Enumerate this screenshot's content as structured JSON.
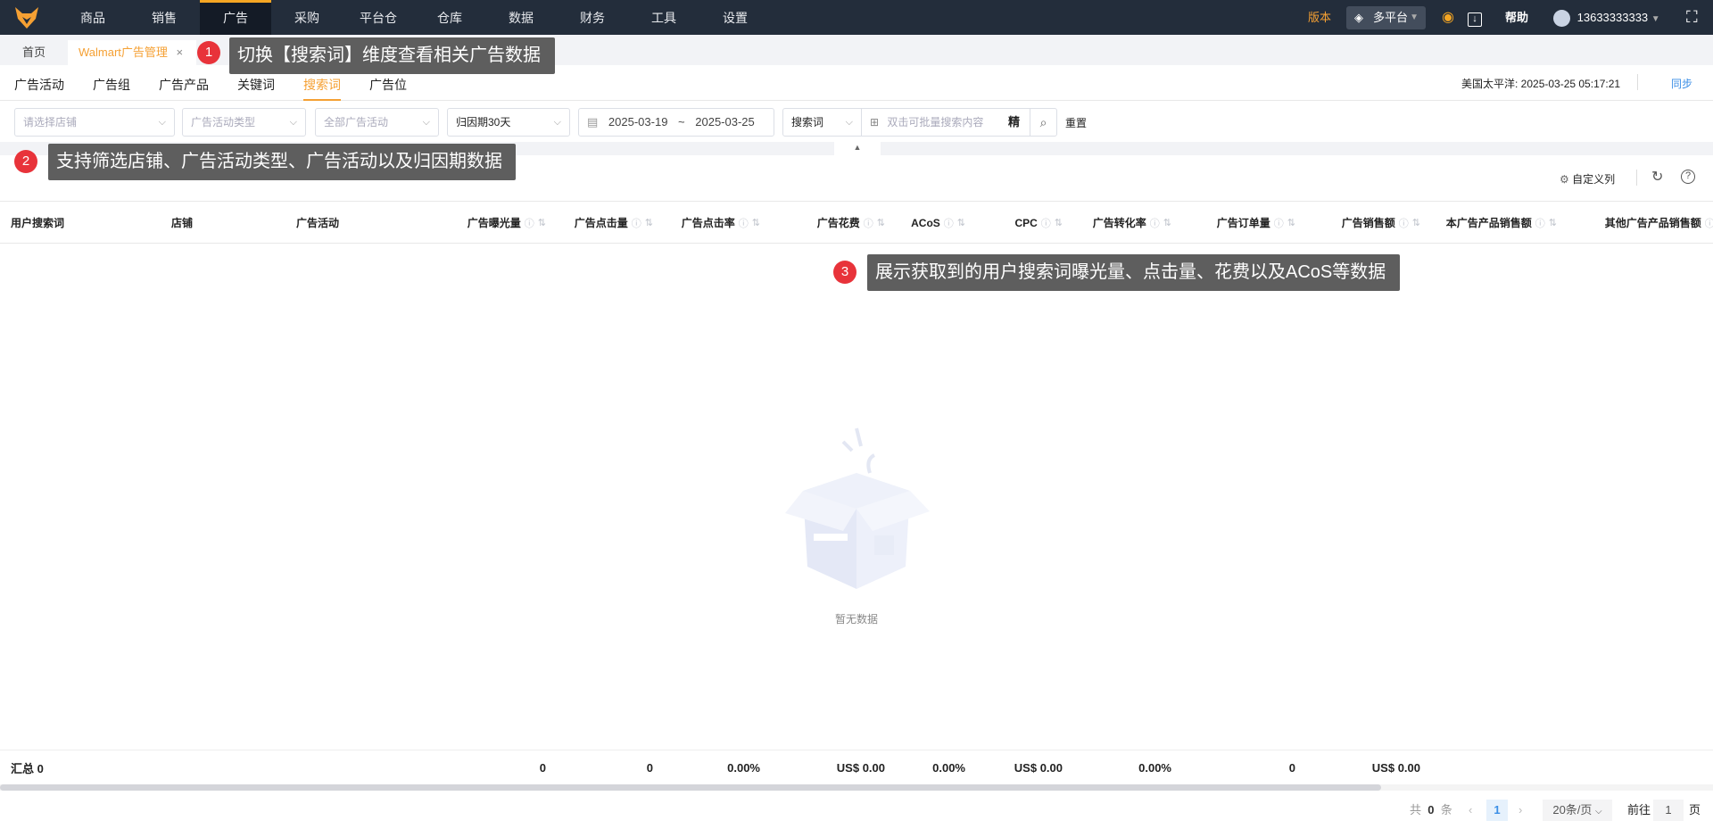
{
  "topnav": {
    "items": [
      "商品",
      "销售",
      "广告",
      "采购",
      "平台仓",
      "仓库",
      "数据",
      "财务",
      "工具",
      "设置"
    ],
    "active": "广告",
    "version": "版本",
    "platform": "多平台",
    "help": "帮助",
    "user": "13633333333"
  },
  "tabs": {
    "home": "首页",
    "current": "Walmart广告管理",
    "close": "×"
  },
  "subtabs": {
    "items": [
      "广告活动",
      "广告组",
      "广告产品",
      "关键词",
      "搜索词",
      "广告位"
    ],
    "active": "搜索词",
    "timezone": "美国太平洋: 2025-03-25 05:17:21",
    "sync": "同步"
  },
  "filters": {
    "store_placeholder": "请选择店铺",
    "type_placeholder": "广告活动类型",
    "campaign_placeholder": "全部广告活动",
    "attribution": "归因期30天",
    "date_start": "2025-03-19",
    "date_sep": "~",
    "date_end": "2025-03-25",
    "search_type": "搜索词",
    "search_placeholder": "双击可批量搜索内容",
    "exact": "精",
    "reset": "重置"
  },
  "toolbar": {
    "custom_columns": "自定义列"
  },
  "table": {
    "headers": [
      "用户搜索词",
      "店铺",
      "广告活动",
      "广告曝光量",
      "广告点击量",
      "广告点击率",
      "广告花费",
      "ACoS",
      "CPC",
      "广告转化率",
      "广告订单量",
      "广告销售额",
      "本广告产品销售额",
      "其他广告产品销售额"
    ],
    "summary": [
      "汇总 0",
      "",
      "",
      "0",
      "0",
      "0.00%",
      "US$ 0.00",
      "0.00%",
      "US$ 0.00",
      "0.00%",
      "0",
      "US$ 0.00",
      "",
      ""
    ],
    "empty": "暂无数据"
  },
  "pagination": {
    "total_prefix": "共",
    "total": "0",
    "total_suffix": "条",
    "current": "1",
    "page_size": "20条/页",
    "goto": "前往",
    "goto_value": "1",
    "page_suffix": "页"
  },
  "callouts": [
    {
      "n": "1",
      "text": "切换【搜索词】维度查看相关广告数据"
    },
    {
      "n": "2",
      "text": "支持筛选店铺、广告活动类型、广告活动以及归因期数据"
    },
    {
      "n": "3",
      "text": "展示获取到的用户搜索词曝光量、点击量、花费以及ACoS等数据"
    }
  ],
  "colors": {
    "accent": "#f5a033",
    "nav_bg": "#232d3b",
    "link": "#3a8ee6"
  }
}
